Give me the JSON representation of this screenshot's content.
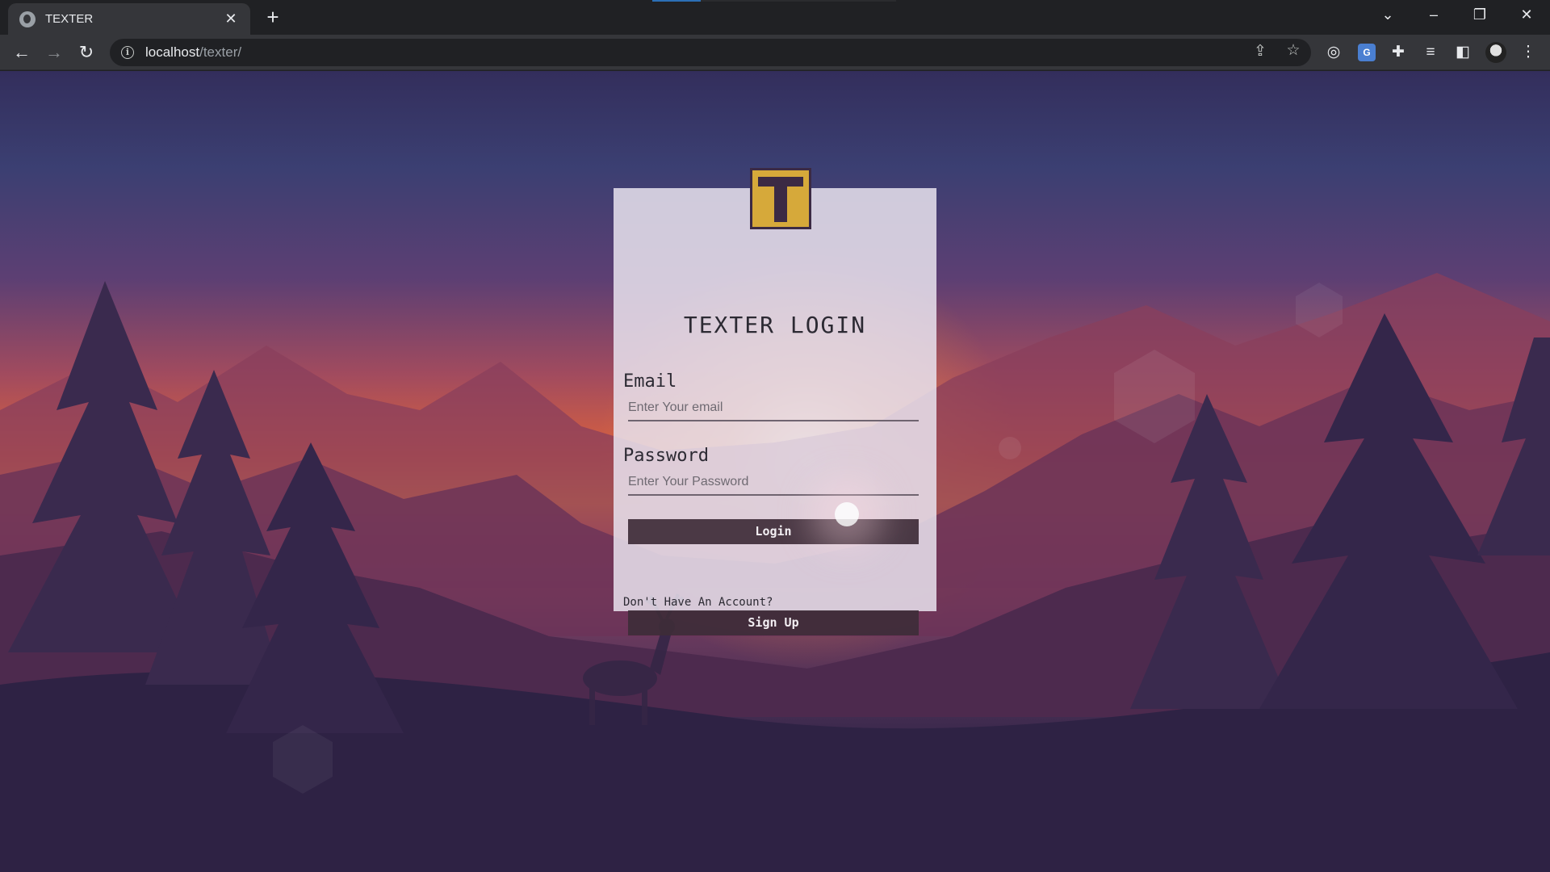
{
  "browser": {
    "tab_title": "TEXTER",
    "url_host": "localhost",
    "url_path": "/texter/"
  },
  "icons": {
    "back": "arrow-left-icon",
    "forward": "arrow-right-icon",
    "reload": "reload-icon",
    "info": "info-icon",
    "share": "share-icon",
    "bookmark": "star-icon",
    "translate": "translate-icon",
    "extensions": "puzzle-icon",
    "reading_list": "reading-list-icon",
    "side_panel": "side-panel-icon",
    "profile": "profile-avatar-icon",
    "menu": "kebab-menu-icon"
  },
  "colors": {
    "logo_gold": "#d6a93a",
    "logo_dark": "#3b2a44",
    "button_bg": "#3e2c38"
  },
  "login": {
    "title": "TEXTER LOGIN",
    "email_label": "Email",
    "email_placeholder": "Enter Your email",
    "password_label": "Password",
    "password_placeholder": "Enter Your Password",
    "login_button": "Login",
    "no_account_text": "Don't Have An Account?",
    "signup_button": "Sign Up"
  }
}
